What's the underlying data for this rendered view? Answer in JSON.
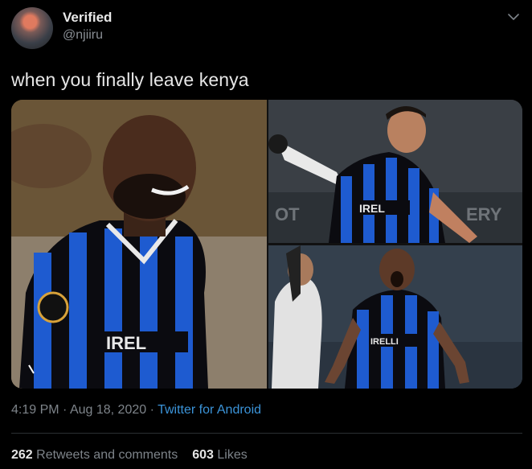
{
  "author": {
    "name": "Verified",
    "handle": "@njiiru"
  },
  "tweet": {
    "text": "when you finally leave kenya"
  },
  "media": {
    "count": 3,
    "main_jersey_text": "IREL",
    "top_right_jersey_text": "IREL",
    "top_right_banner": "OT",
    "top_right_banner_2": "ERY",
    "bottom_right_jersey_text": "IRELLI"
  },
  "meta": {
    "time": "4:19 PM",
    "separator": "·",
    "date": "Aug 18, 2020",
    "app": "Twitter for Android"
  },
  "stats": {
    "retweets_count": "262",
    "retweets_label": "Retweets and comments",
    "likes_count": "603",
    "likes_label": "Likes"
  },
  "colors": {
    "background": "#000000",
    "link": "#3b94d9",
    "inter_blue": "#1e5bd0",
    "inter_black": "#0b0b10"
  }
}
